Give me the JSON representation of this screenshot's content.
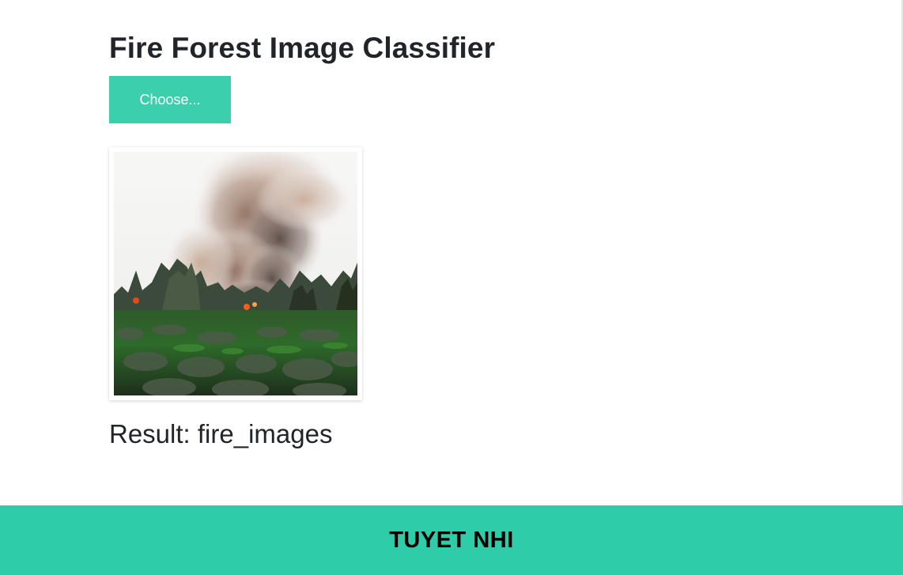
{
  "page": {
    "title": "Fire Forest Image Classifier"
  },
  "upload": {
    "choose_label": "Choose..."
  },
  "preview": {
    "icon": "uploaded-forest-fire-photo"
  },
  "result": {
    "label": "Result: fire_images"
  },
  "footer": {
    "text": "TUYET NHI"
  },
  "colors": {
    "accent": "#2ecca9",
    "button": "#3ccfae",
    "text": "#212529"
  }
}
